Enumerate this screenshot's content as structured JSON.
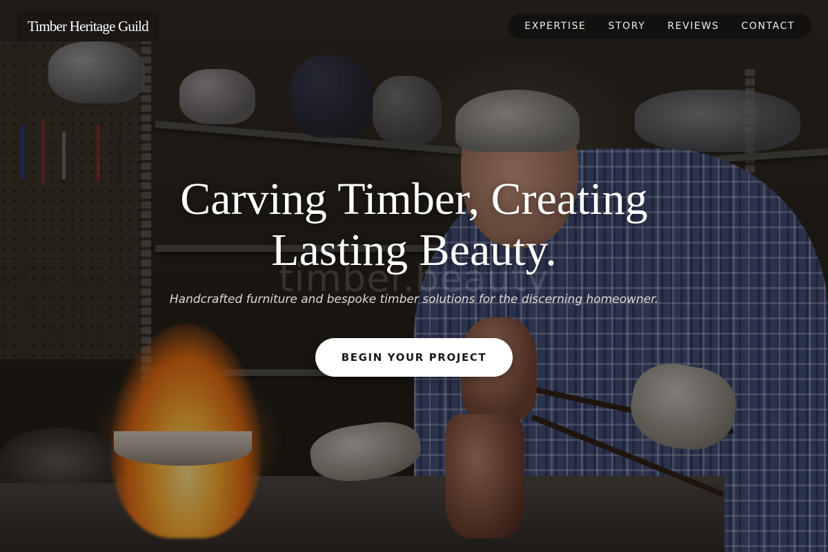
{
  "header": {
    "brand": "Timber Heritage Guild",
    "nav": [
      {
        "label": "EXPERTISE"
      },
      {
        "label": "STORY"
      },
      {
        "label": "REVIEWS"
      },
      {
        "label": "CONTACT"
      }
    ]
  },
  "hero": {
    "headline_line1": "Carving Timber, Creating",
    "headline_line2": "Lasting Beauty.",
    "ghost_text": "timber.beauty",
    "tagline": "Handcrafted furniture and bespoke timber solutions for the discerning homeowner.",
    "cta_label": "BEGIN YOUR PROJECT",
    "background_image": "craftsman-workshop-photo"
  },
  "colors": {
    "cta_background": "#ffffff",
    "nav_background": "#12100f",
    "text_primary": "#ffffff"
  }
}
